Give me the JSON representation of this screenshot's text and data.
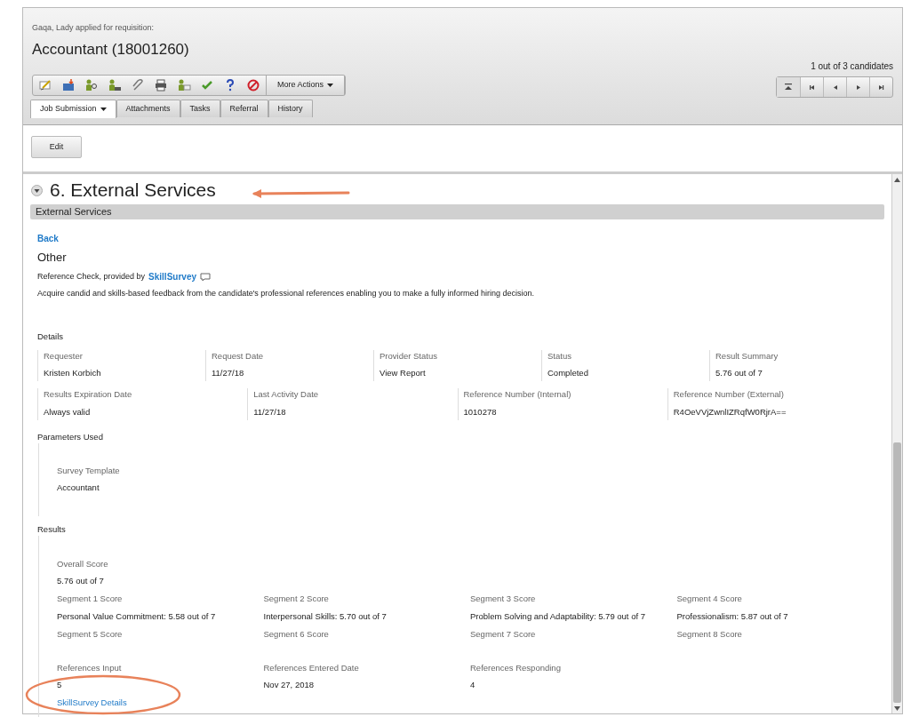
{
  "header": {
    "context": "Gaqa, Lady applied for requisition:",
    "title": "Accountant (18001260)",
    "candidate_counter": "1 out of 3 candidates"
  },
  "toolbar": {
    "more_actions": "More Actions"
  },
  "tabs": [
    {
      "label": "Job Submission",
      "selected": true,
      "dropdown": true
    },
    {
      "label": "Attachments",
      "selected": false,
      "dropdown": false
    },
    {
      "label": "Tasks",
      "selected": false,
      "dropdown": false
    },
    {
      "label": "Referral",
      "selected": false,
      "dropdown": false
    },
    {
      "label": "History",
      "selected": false,
      "dropdown": false
    }
  ],
  "edit_button": "Edit",
  "section": {
    "title": "6. External Services",
    "expanded": true,
    "subheader": "External Services",
    "back_link": "Back",
    "category": "Other",
    "provider_intro": "Reference Check, provided by",
    "provider_name": "SkillSurvey",
    "description": "Acquire candid and skills-based feedback from the candidate's professional references enabling you to make a fully informed hiring decision."
  },
  "details": {
    "label": "Details",
    "request_fields": [
      {
        "label": "Requester",
        "value": "Kristen Korbich"
      },
      {
        "label": "Request Date",
        "value": "11/27/18"
      },
      {
        "label": "Provider Status",
        "value": "View Report"
      },
      {
        "label": "Status",
        "value": "Completed"
      },
      {
        "label": "Result Summary",
        "value": "5.76 out of 7"
      }
    ],
    "reference_fields": [
      {
        "label": "Results Expiration Date",
        "value": "Always valid"
      },
      {
        "label": "Last Activity Date",
        "value": "11/27/18"
      },
      {
        "label": "Reference Number (Internal)",
        "value": "1010278"
      },
      {
        "label": "Reference Number (External)",
        "value": "R4OeVVjZwnlIZRqfW0RjrA=="
      }
    ]
  },
  "parameters": {
    "label": "Parameters Used",
    "fields": [
      {
        "label": "Survey Template",
        "value": "Accountant"
      }
    ]
  },
  "results": {
    "label": "Results",
    "overall": {
      "label": "Overall Score",
      "value": "5.76 out of 7"
    },
    "segments": [
      {
        "label": "Segment 1 Score",
        "value": "Personal Value Commitment: 5.58 out of 7"
      },
      {
        "label": "Segment 2 Score",
        "value": "Interpersonal Skills: 5.70 out of 7"
      },
      {
        "label": "Segment 3 Score",
        "value": "Problem Solving and Adaptability: 5.79 out of 7"
      },
      {
        "label": "Segment 4 Score",
        "value": "Professionalism: 5.87 out of 7"
      },
      {
        "label": "Segment 5 Score"
      },
      {
        "label": "Segment 6 Score"
      },
      {
        "label": "Segment 7 Score"
      },
      {
        "label": "Segment 8 Score"
      }
    ],
    "references": [
      {
        "label": "References Input",
        "value": "5"
      },
      {
        "label": "References Entered Date",
        "value": "Nov 27, 2018"
      },
      {
        "label": "References Responding",
        "value": "4"
      }
    ],
    "details_link": "SkillSurvey Details"
  }
}
